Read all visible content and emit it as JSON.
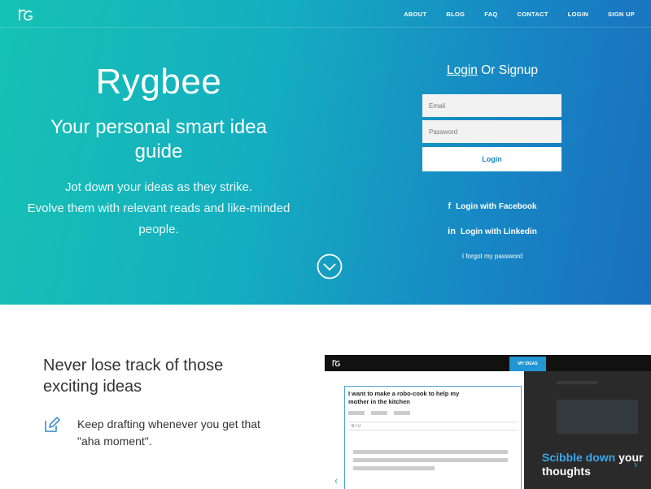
{
  "nav": {
    "items": [
      "ABOUT",
      "BLOG",
      "FAQ",
      "CONTACT",
      "LOGIN",
      "SIGN UP"
    ]
  },
  "hero": {
    "brand": "Rygbee",
    "tagline": "Your personal smart idea guide",
    "desc_line1": "Jot down your ideas as they strike.",
    "desc_line2": "Evolve them with relevant reads and like-minded people."
  },
  "auth": {
    "login_link": "Login",
    "or_signup": " Or Signup",
    "email_placeholder": "Email",
    "password_placeholder": "Password",
    "login_button": "Login",
    "facebook": "Login with Facebook",
    "linkedin": "Login with Linkedin",
    "forgot": "I forgot my password"
  },
  "feature": {
    "title": "Never lose track of those exciting ideas",
    "text": "Keep drafting whenever you get that \"aha moment\"."
  },
  "mockup": {
    "tab": "MY IDEAS",
    "editor_title": "I want to make a robo-cook to help my mother in the kitchen",
    "editor_format": "B  I  U",
    "caption_hl": "Scibble down",
    "caption_rest": " your thoughts"
  },
  "colors": {
    "accent": "#1a86c4",
    "teal": "#16c2b4"
  },
  "icons": {
    "logo": "rygbee-logo",
    "down": "chevron-down-circle-icon",
    "edit": "pencil-edit-icon"
  }
}
